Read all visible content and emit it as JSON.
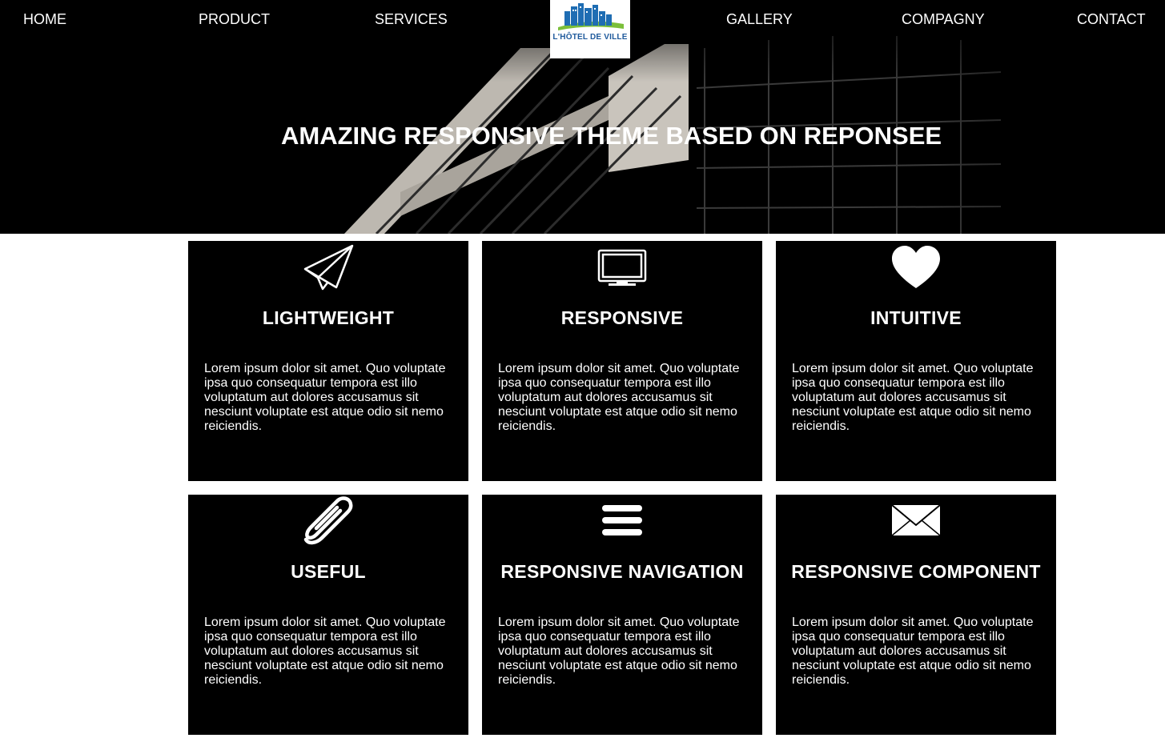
{
  "nav": {
    "items": [
      {
        "label": "HOME"
      },
      {
        "label": "PRODUCT"
      },
      {
        "label": "SERVICES"
      },
      {
        "label": "GALLERY"
      },
      {
        "label": "COMPAGNY"
      },
      {
        "label": "CONTACT"
      }
    ],
    "logo_text": "L'HÔTEL DE VILLE"
  },
  "hero": {
    "title": "AMAZING RESPONSIVE THEME BASED ON REPONSEE"
  },
  "features": [
    {
      "icon": "paper-plane-icon",
      "title": "LIGHTWEIGHT",
      "text": "Lorem ipsum dolor sit amet. Quo voluptate ipsa quo consequatur tempora est illo voluptatum aut dolores accusamus sit nesciunt voluptate est atque odio sit nemo reiciendis."
    },
    {
      "icon": "monitor-icon",
      "title": "RESPONSIVE",
      "text": "Lorem ipsum dolor sit amet. Quo voluptate ipsa quo consequatur tempora est illo voluptatum aut dolores accusamus sit nesciunt voluptate est atque odio sit nemo reiciendis."
    },
    {
      "icon": "heart-icon",
      "title": "INTUITIVE",
      "text": "Lorem ipsum dolor sit amet. Quo voluptate ipsa quo consequatur tempora est illo voluptatum aut dolores accusamus sit nesciunt voluptate est atque odio sit nemo reiciendis."
    },
    {
      "icon": "paperclip-icon",
      "title": "USEFUL",
      "text": "Lorem ipsum dolor sit amet. Quo voluptate ipsa quo consequatur tempora est illo voluptatum aut dolores accusamus sit nesciunt voluptate est atque odio sit nemo reiciendis."
    },
    {
      "icon": "hamburger-menu-icon",
      "title": "RESPONSIVE NAVIGATION",
      "text": "Lorem ipsum dolor sit amet. Quo voluptate ipsa quo consequatur tempora est illo voluptatum aut dolores accusamus sit nesciunt voluptate est atque odio sit nemo reiciendis."
    },
    {
      "icon": "envelope-icon",
      "title": "RESPONSIVE COMPONENT",
      "text": "Lorem ipsum dolor sit amet. Quo voluptate ipsa quo consequatur tempora est illo voluptatum aut dolores accusamus sit nesciunt voluptate est atque odio sit nemo reiciendis."
    }
  ],
  "colors": {
    "background": "#ffffff",
    "card": "#000000",
    "text": "#ffffff",
    "logo_blue": "#1f5a9c",
    "logo_green": "#7bbf3a"
  }
}
